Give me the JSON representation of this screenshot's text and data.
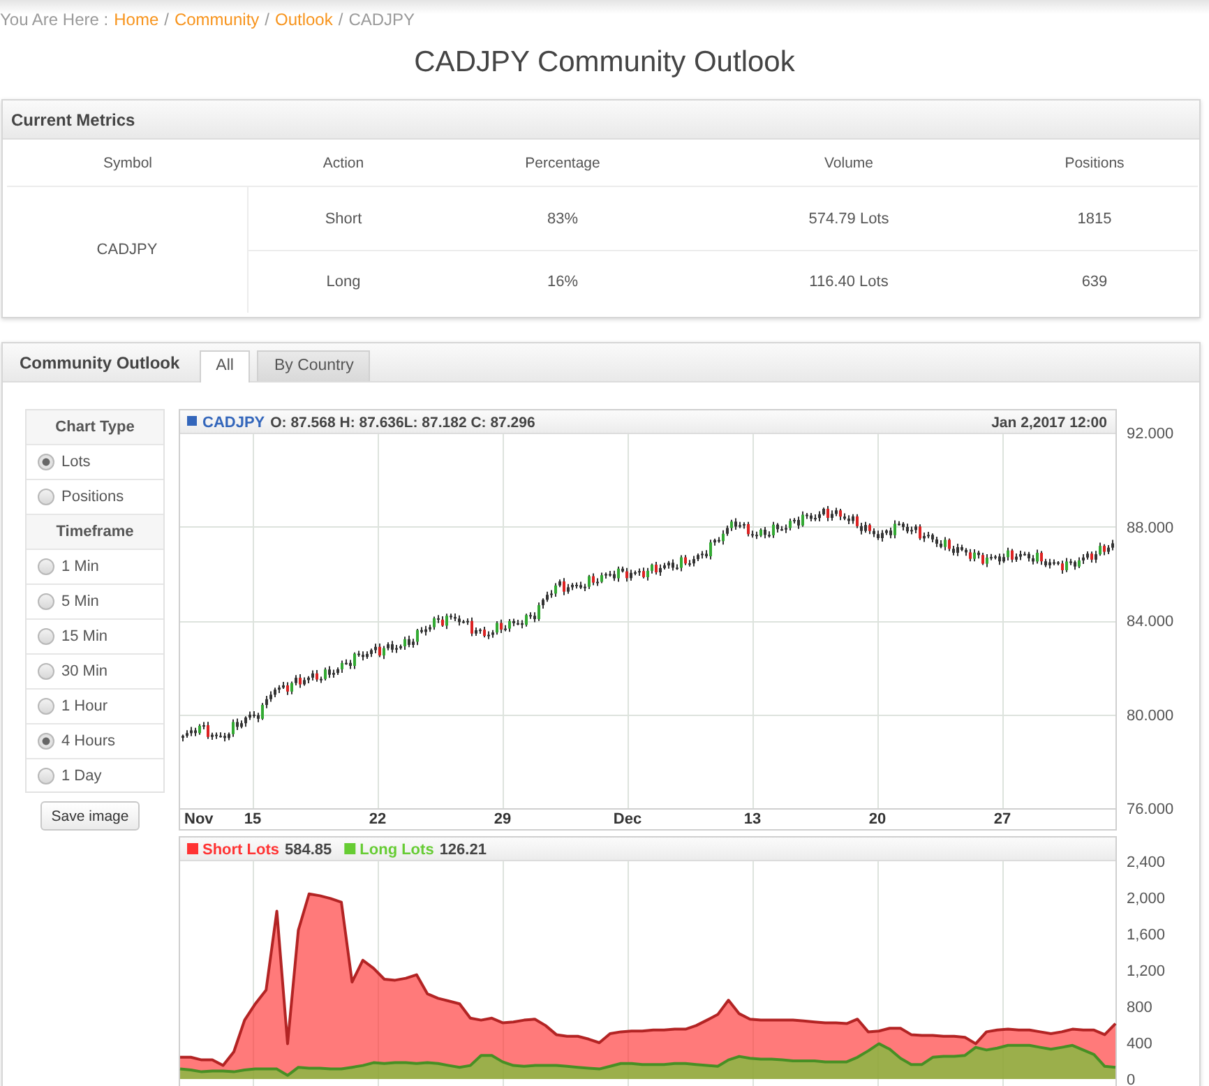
{
  "breadcrumb": {
    "prefix": "You Are Here :",
    "links": [
      "Home",
      "Community",
      "Outlook"
    ],
    "separator": "/",
    "current": "CADJPY"
  },
  "page_title": "CADJPY Community Outlook",
  "metrics": {
    "title": "Current Metrics",
    "columns": [
      "Symbol",
      "Action",
      "Percentage",
      "Volume",
      "Positions"
    ],
    "symbol": "CADJPY",
    "rows": [
      {
        "action": "Short",
        "percentage": "83%",
        "volume": "574.79 Lots",
        "positions": "1815"
      },
      {
        "action": "Long",
        "percentage": "16%",
        "volume": "116.40 Lots",
        "positions": "639"
      }
    ]
  },
  "outlook": {
    "title": "Community Outlook",
    "tabs": [
      {
        "label": "All",
        "selected": true
      },
      {
        "label": "By Country",
        "selected": false
      }
    ],
    "sidebar": {
      "sections": [
        {
          "heading": "Chart Type",
          "options": [
            {
              "label": "Lots",
              "selected": true
            },
            {
              "label": "Positions",
              "selected": false
            }
          ]
        },
        {
          "heading": "Timeframe",
          "options": [
            {
              "label": "1 Min",
              "selected": false
            },
            {
              "label": "5 Min",
              "selected": false
            },
            {
              "label": "15 Min",
              "selected": false
            },
            {
              "label": "30 Min",
              "selected": false
            },
            {
              "label": "1 Hour",
              "selected": false
            },
            {
              "label": "4 Hours",
              "selected": true
            },
            {
              "label": "1 Day",
              "selected": false
            }
          ]
        }
      ]
    },
    "save_button": "Save image",
    "price_chart": {
      "symbol": "CADJPY",
      "ohlc": "O: 87.568 H: 87.636L: 87.182 C: 87.296",
      "datetime": "Jan 2,2017 12:00",
      "y_labels": [
        "92.000",
        "88.000",
        "84.000",
        "80.000",
        "76.000"
      ],
      "x_labels": [
        "Nov",
        "15",
        "22",
        "29",
        "Dec",
        "13",
        "20",
        "27"
      ]
    },
    "volume_chart": {
      "legend_values": [
        "584.85",
        "126.21"
      ],
      "chart_data": {
        "type": "area",
        "legend": "top-left",
        "categories": [
          null,
          null,
          null,
          null,
          null,
          null,
          null,
          null,
          null,
          null,
          null,
          null,
          null,
          null,
          null,
          null,
          null,
          null,
          null,
          null,
          null,
          null,
          null,
          null,
          null,
          null,
          null,
          null,
          null,
          null,
          null,
          null,
          null,
          null,
          null,
          null,
          null,
          null,
          null,
          null,
          null,
          null,
          null,
          null,
          null,
          null,
          null,
          null,
          null,
          null,
          null,
          null,
          null,
          null,
          null,
          null,
          null,
          null,
          null,
          null,
          null,
          null,
          null,
          null,
          null,
          null,
          null,
          null,
          null,
          null,
          null,
          null,
          null,
          null,
          null,
          null,
          null,
          null,
          null,
          null,
          null,
          null,
          null,
          null,
          null,
          null,
          null,
          null
        ],
        "series": [
          {
            "name": "Short Lots",
            "color": "#ff3333",
            "values": [
              240,
              240,
              210,
              210,
              150,
              300,
              650,
              830,
              980,
              1850,
              390,
              1640,
              2040,
              2020,
              1990,
              1950,
              1070,
              1310,
              1220,
              1100,
              1090,
              1110,
              1150,
              940,
              890,
              860,
              830,
              670,
              650,
              670,
              620,
              630,
              650,
              660,
              590,
              490,
              470,
              470,
              440,
              400,
              500,
              520,
              530,
              530,
              540,
              540,
              550,
              550,
              590,
              650,
              710,
              870,
              720,
              660,
              650,
              650,
              650,
              650,
              640,
              630,
              620,
              620,
              610,
              660,
              520,
              530,
              560,
              560,
              490,
              480,
              480,
              470,
              470,
              460,
              390,
              520,
              540,
              550,
              540,
              540,
              520,
              500,
              520,
              550,
              540,
              540,
              490,
              610
            ]
          },
          {
            "name": "Long Lots",
            "color": "#66cc33",
            "values": [
              110,
              100,
              80,
              90,
              90,
              80,
              100,
              110,
              110,
              110,
              40,
              130,
              120,
              120,
              110,
              110,
              130,
              150,
              180,
              170,
              180,
              180,
              170,
              180,
              170,
              150,
              130,
              150,
              260,
              260,
              190,
              150,
              140,
              150,
              150,
              150,
              140,
              130,
              120,
              110,
              140,
              170,
              170,
              160,
              160,
              160,
              170,
              170,
              160,
              150,
              140,
              210,
              250,
              230,
              220,
              220,
              210,
              200,
              200,
              200,
              190,
              190,
              190,
              240,
              310,
              390,
              330,
              230,
              160,
              160,
              240,
              250,
              250,
              260,
              350,
              320,
              340,
              370,
              370,
              370,
              350,
              330,
              350,
              370,
              320,
              270,
              140,
              130
            ]
          }
        ],
        "ylim": [
          0,
          2400
        ],
        "yticks": [
          {
            "value": 0,
            "label": "0"
          },
          {
            "value": 400,
            "label": "400"
          },
          {
            "value": 800,
            "label": "800"
          },
          {
            "value": 1200,
            "label": "1,200"
          },
          {
            "value": 1600,
            "label": "1,600"
          },
          {
            "value": 2000,
            "label": "2,000"
          },
          {
            "value": 2400,
            "label": "2,400"
          }
        ]
      }
    }
  }
}
